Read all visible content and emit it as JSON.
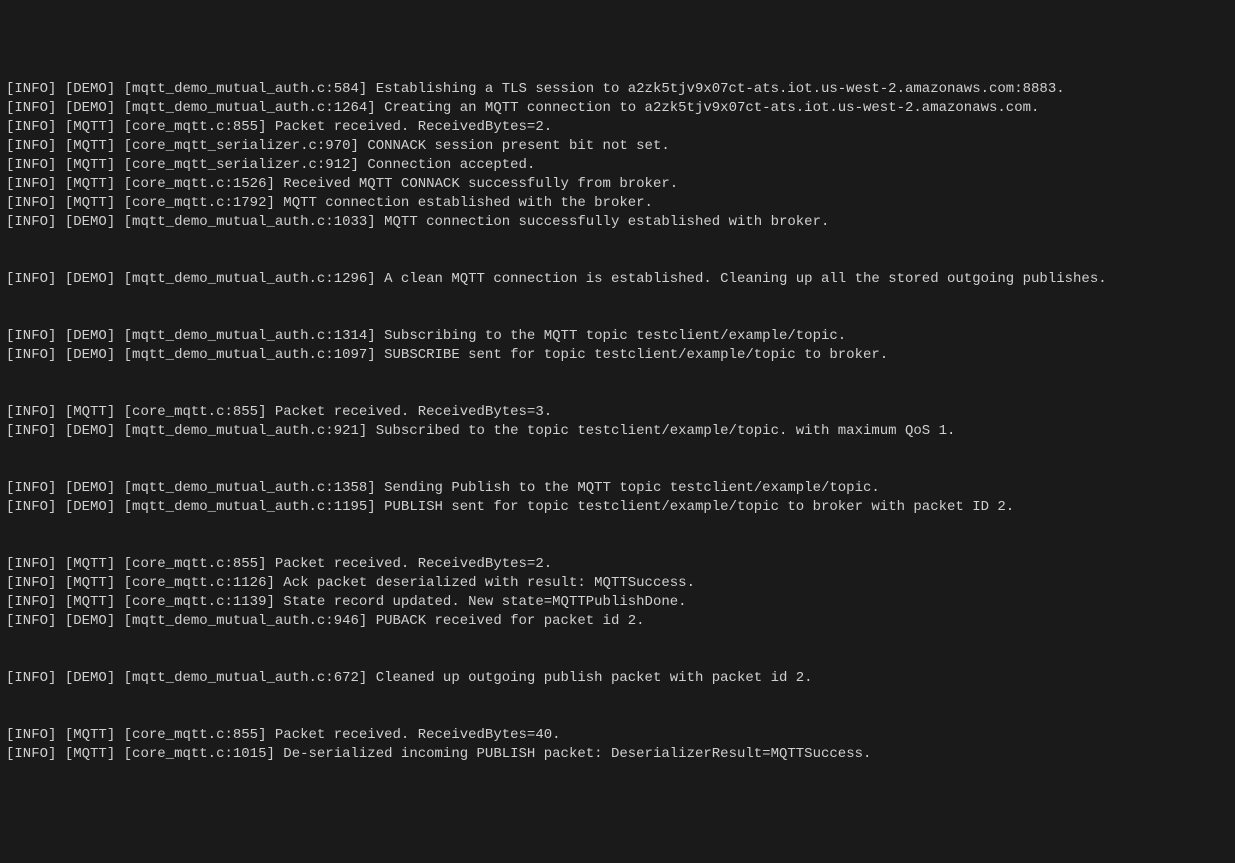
{
  "logs": [
    {
      "level": "[INFO]",
      "tag": "[DEMO]",
      "source": "[mqtt_demo_mutual_auth.c:584]",
      "message": "Establishing a TLS session to a2zk5tjv9x07ct-ats.iot.us-west-2.amazonaws.com:8883."
    },
    {
      "level": "[INFO]",
      "tag": "[DEMO]",
      "source": "[mqtt_demo_mutual_auth.c:1264]",
      "message": "Creating an MQTT connection to a2zk5tjv9x07ct-ats.iot.us-west-2.amazonaws.com."
    },
    {
      "level": "[INFO]",
      "tag": "[MQTT]",
      "source": "[core_mqtt.c:855]",
      "message": "Packet received. ReceivedBytes=2."
    },
    {
      "level": "[INFO]",
      "tag": "[MQTT]",
      "source": "[core_mqtt_serializer.c:970]",
      "message": "CONNACK session present bit not set."
    },
    {
      "level": "[INFO]",
      "tag": "[MQTT]",
      "source": "[core_mqtt_serializer.c:912]",
      "message": "Connection accepted."
    },
    {
      "level": "[INFO]",
      "tag": "[MQTT]",
      "source": "[core_mqtt.c:1526]",
      "message": "Received MQTT CONNACK successfully from broker."
    },
    {
      "level": "[INFO]",
      "tag": "[MQTT]",
      "source": "[core_mqtt.c:1792]",
      "message": "MQTT connection established with the broker."
    },
    {
      "level": "[INFO]",
      "tag": "[DEMO]",
      "source": "[mqtt_demo_mutual_auth.c:1033]",
      "message": "MQTT connection successfully established with broker."
    },
    {
      "blank": true
    },
    {
      "blank": true
    },
    {
      "level": "[INFO]",
      "tag": "[DEMO]",
      "source": "[mqtt_demo_mutual_auth.c:1296]",
      "message": "A clean MQTT connection is established. Cleaning up all the stored outgoing publishes."
    },
    {
      "blank": true
    },
    {
      "blank": true
    },
    {
      "level": "[INFO]",
      "tag": "[DEMO]",
      "source": "[mqtt_demo_mutual_auth.c:1314]",
      "message": "Subscribing to the MQTT topic testclient/example/topic."
    },
    {
      "level": "[INFO]",
      "tag": "[DEMO]",
      "source": "[mqtt_demo_mutual_auth.c:1097]",
      "message": "SUBSCRIBE sent for topic testclient/example/topic to broker."
    },
    {
      "blank": true
    },
    {
      "blank": true
    },
    {
      "level": "[INFO]",
      "tag": "[MQTT]",
      "source": "[core_mqtt.c:855]",
      "message": "Packet received. ReceivedBytes=3."
    },
    {
      "level": "[INFO]",
      "tag": "[DEMO]",
      "source": "[mqtt_demo_mutual_auth.c:921]",
      "message": "Subscribed to the topic testclient/example/topic. with maximum QoS 1."
    },
    {
      "blank": true
    },
    {
      "blank": true
    },
    {
      "level": "[INFO]",
      "tag": "[DEMO]",
      "source": "[mqtt_demo_mutual_auth.c:1358]",
      "message": "Sending Publish to the MQTT topic testclient/example/topic."
    },
    {
      "level": "[INFO]",
      "tag": "[DEMO]",
      "source": "[mqtt_demo_mutual_auth.c:1195]",
      "message": "PUBLISH sent for topic testclient/example/topic to broker with packet ID 2."
    },
    {
      "blank": true
    },
    {
      "blank": true
    },
    {
      "level": "[INFO]",
      "tag": "[MQTT]",
      "source": "[core_mqtt.c:855]",
      "message": "Packet received. ReceivedBytes=2."
    },
    {
      "level": "[INFO]",
      "tag": "[MQTT]",
      "source": "[core_mqtt.c:1126]",
      "message": "Ack packet deserialized with result: MQTTSuccess."
    },
    {
      "level": "[INFO]",
      "tag": "[MQTT]",
      "source": "[core_mqtt.c:1139]",
      "message": "State record updated. New state=MQTTPublishDone."
    },
    {
      "level": "[INFO]",
      "tag": "[DEMO]",
      "source": "[mqtt_demo_mutual_auth.c:946]",
      "message": "PUBACK received for packet id 2."
    },
    {
      "blank": true
    },
    {
      "blank": true
    },
    {
      "level": "[INFO]",
      "tag": "[DEMO]",
      "source": "[mqtt_demo_mutual_auth.c:672]",
      "message": "Cleaned up outgoing publish packet with packet id 2."
    },
    {
      "blank": true
    },
    {
      "blank": true
    },
    {
      "level": "[INFO]",
      "tag": "[MQTT]",
      "source": "[core_mqtt.c:855]",
      "message": "Packet received. ReceivedBytes=40."
    },
    {
      "level": "[INFO]",
      "tag": "[MQTT]",
      "source": "[core_mqtt.c:1015]",
      "message": "De-serialized incoming PUBLISH packet: DeserializerResult=MQTTSuccess."
    }
  ]
}
